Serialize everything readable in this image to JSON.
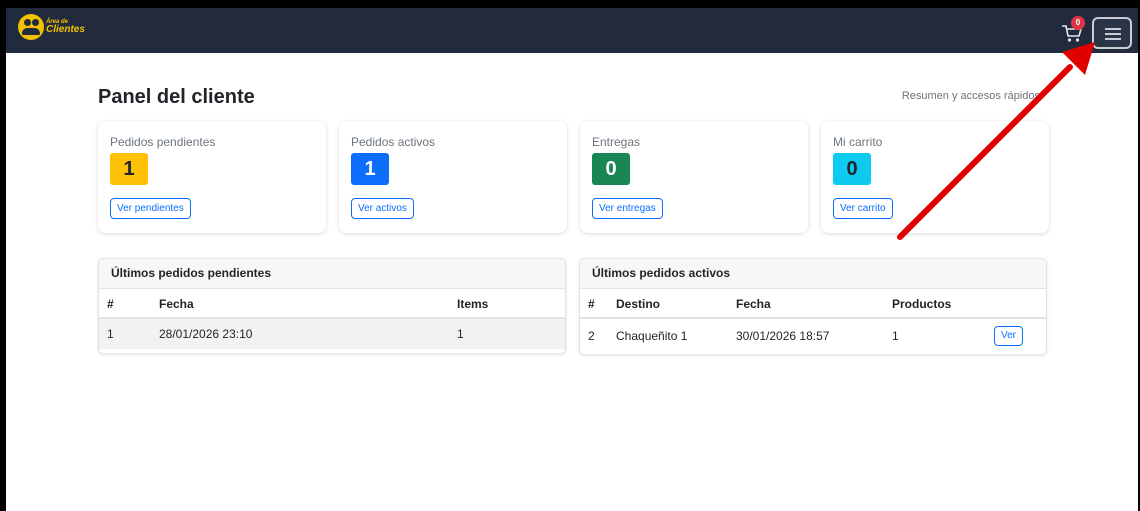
{
  "brand": {
    "line1": "Área de",
    "line2": "Clientes"
  },
  "cart_count": "0",
  "title": "Panel del cliente",
  "subtitle": "Resumen y accesos rápidos",
  "cards": [
    {
      "label": "Pedidos pendientes",
      "value": "1",
      "button": "Ver pendientes",
      "color": "#ffc107"
    },
    {
      "label": "Pedidos activos",
      "value": "1",
      "button": "Ver activos",
      "color": "#0d6efd"
    },
    {
      "label": "Entregas",
      "value": "0",
      "button": "Ver entregas",
      "color": "#198754"
    },
    {
      "label": "Mi carrito",
      "value": "0",
      "button": "Ver carrito",
      "color": "#0dcaf0"
    }
  ],
  "pending": {
    "title": "Últimos pedidos pendientes",
    "headers": [
      "#",
      "Fecha",
      "Items"
    ],
    "rows": [
      [
        "1",
        "28/01/2026 23:10",
        "1"
      ]
    ]
  },
  "active": {
    "title": "Últimos pedidos activos",
    "headers": [
      "#",
      "Destino",
      "Fecha",
      "Productos"
    ],
    "rows": [
      [
        "2",
        "Chaqueñito 1",
        "30/01/2026 18:57",
        "1",
        "Ver"
      ]
    ]
  },
  "colors": {
    "navbar": "#212b3d",
    "accent": "#0d6efd",
    "annotation_arrow": "#e00000"
  }
}
